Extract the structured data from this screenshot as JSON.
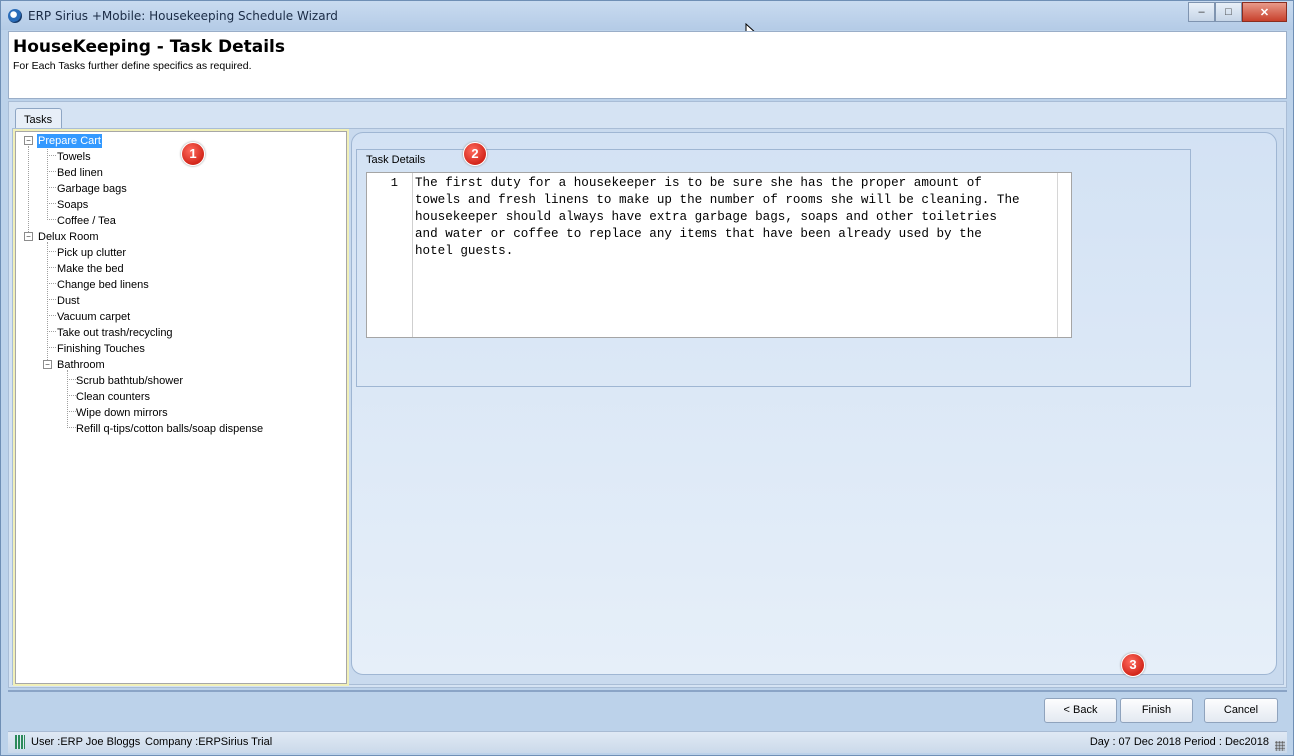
{
  "window": {
    "title": "ERP Sirius +Mobile: Housekeeping Schedule Wizard",
    "minimize": "–",
    "maximize": "□",
    "close": "✕"
  },
  "header": {
    "title": "HouseKeeping - Task Details",
    "subtitle": "For Each Tasks further define specifics as required."
  },
  "tabs": [
    {
      "label": "Tasks"
    }
  ],
  "tree": {
    "nodes": [
      {
        "label": "Prepare Cart",
        "selected": true
      },
      {
        "label": "Towels"
      },
      {
        "label": "Bed linen"
      },
      {
        "label": "Garbage bags"
      },
      {
        "label": "Soaps"
      },
      {
        "label": "Coffee / Tea"
      },
      {
        "label": "Delux Room"
      },
      {
        "label": "Pick up clutter"
      },
      {
        "label": "Make the bed"
      },
      {
        "label": "Change bed linens"
      },
      {
        "label": "Dust"
      },
      {
        "label": "Vacuum carpet"
      },
      {
        "label": "Take out trash/recycling"
      },
      {
        "label": "Finishing Touches"
      },
      {
        "label": "Bathroom"
      },
      {
        "label": "Scrub bathtub/shower"
      },
      {
        "label": "Clean counters"
      },
      {
        "label": "Wipe down mirrors"
      },
      {
        "label": "Refill q-tips/cotton balls/soap dispense"
      }
    ]
  },
  "details": {
    "group_label": "Task Details",
    "line_number": "1",
    "text": "The first duty for a housekeeper is to be sure she has the proper amount of\ntowels and fresh linens to make up the number of rooms she will be cleaning. The\nhousekeeper should always have extra garbage bags, soaps and other toiletries\nand water or coffee to replace any items that have been already used by the\nhotel guests."
  },
  "badges": [
    "1",
    "2",
    "3"
  ],
  "buttons": {
    "back": "< Back",
    "finish": "Finish",
    "cancel": "Cancel"
  },
  "status": {
    "user": "User :ERP Joe Bloggs",
    "company": "Company :ERPSirius Trial",
    "date_period": "Day : 07 Dec 2018  Period : Dec2018"
  },
  "colors": {
    "selection": "#3399ff",
    "badge": "#d3261a"
  }
}
